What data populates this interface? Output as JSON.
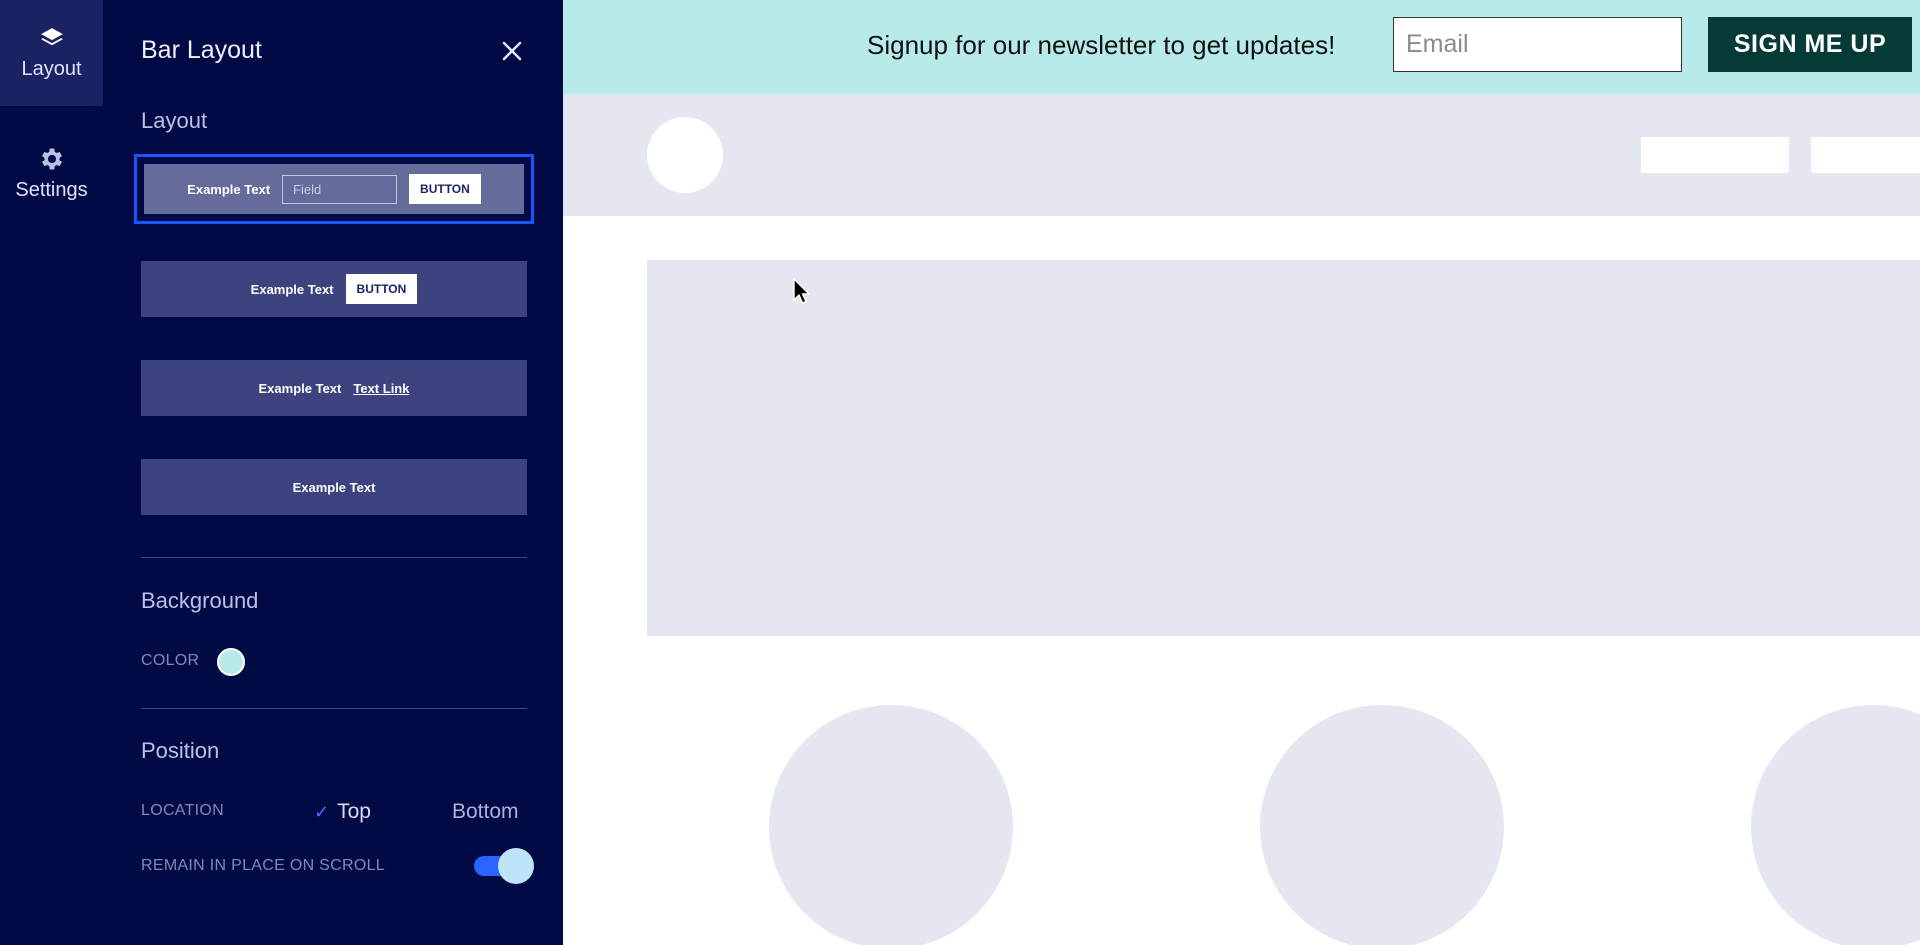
{
  "rail": {
    "items": [
      {
        "label": "Layout",
        "icon": "layers-icon",
        "active": true
      },
      {
        "label": "Settings",
        "icon": "gear-icon",
        "active": false
      }
    ]
  },
  "panel": {
    "title": "Bar Layout",
    "layout_section": {
      "heading": "Layout",
      "options": [
        {
          "text": "Example Text",
          "field_placeholder": "Field",
          "button": "BUTTON",
          "selected": true
        },
        {
          "text": "Example Text",
          "button": "BUTTON",
          "selected": false
        },
        {
          "text": "Example Text",
          "link": "Text Link",
          "selected": false
        },
        {
          "text": "Example Text",
          "selected": false
        }
      ]
    },
    "background_section": {
      "heading": "Background",
      "color_label": "COLOR",
      "color_value": "#b8eaea"
    },
    "position_section": {
      "heading": "Position",
      "location_label": "LOCATION",
      "location_options": [
        "Top",
        "Bottom"
      ],
      "location_selected": "Top",
      "remain_label": "REMAIN IN PLACE ON SCROLL",
      "remain_enabled": true
    }
  },
  "preview": {
    "newsletter": {
      "text": "Signup for our newsletter to get updates!",
      "email_placeholder": "Email",
      "button": "SIGN ME UP",
      "bg_color": "#b8eaea",
      "button_color": "#063a36"
    }
  },
  "colors": {
    "panel_bg": "#020a45",
    "accent": "#1a56ff",
    "placeholder": "#e4e7ef"
  }
}
